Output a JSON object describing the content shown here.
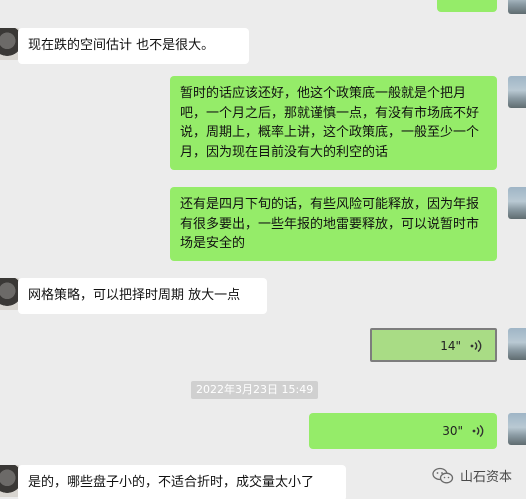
{
  "messages": [
    {
      "id": "m1",
      "text": "现在跌的空间估计 也不是很大。"
    },
    {
      "id": "m2",
      "text": "暂时的话应该还好，他这个政策底一般就是个把月吧，一个月之后，那就谨慎一点，有没有市场底不好说，周期上，概率上讲，这个政策底，一般至少一个月，因为现在目前没有大的利空的话"
    },
    {
      "id": "m3",
      "text": "还有是四月下旬的话，有些风险可能释放，因为年报有很多要出，一些年报的地雷要释放，可以说暂时市场是安全的"
    },
    {
      "id": "m4",
      "text": "网格策略，可以把择时周期 放大一点"
    },
    {
      "id": "m5",
      "duration": "14\""
    },
    {
      "id": "m6",
      "duration": "30\""
    },
    {
      "id": "m7",
      "text": "是的，哪些盘子小的，不适合折时，成交量太小了"
    }
  ],
  "timestamp": "2022年3月23日 15:49",
  "watermark": {
    "label": "山石资本",
    "icon": "wechat-official-account-icon"
  },
  "colors": {
    "background": "#ececec",
    "green_bubble": "#95ec69",
    "white_bubble": "#ffffff"
  }
}
